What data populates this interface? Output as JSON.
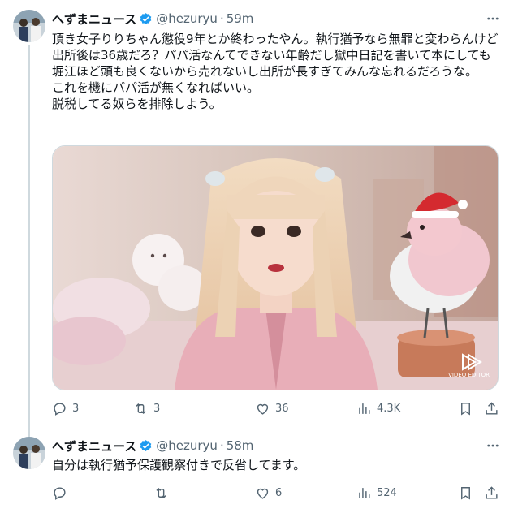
{
  "tweets": [
    {
      "display_name": "へずまニュース",
      "handle": "@hezuryu",
      "separator": "·",
      "time": "59m",
      "text": "頂き女子りりちゃん懲役9年とか終わったやん。執行猶予なら無罪と変わらんけど出所後は36歳だろ？パパ活なんてできない年齢だし獄中日記を書いて本にしても堀江ほど頭も良くないから売れないし出所が長すぎてみんな忘れるだろうな。\nこれを機にパパ活が無くなればいい。\n脱税してる奴らを排除しよう。",
      "media_watermark": "VIDEO EDITOR",
      "actions": {
        "replies": "3",
        "reposts": "3",
        "likes": "36",
        "views": "4.3K"
      }
    },
    {
      "display_name": "へずまニュース",
      "handle": "@hezuryu",
      "separator": "·",
      "time": "58m",
      "text": "自分は執行猶予保護観察付きで反省してます。",
      "actions": {
        "replies": "",
        "reposts": "",
        "likes": "6",
        "views": "524"
      }
    }
  ],
  "colors": {
    "text": "#0f1419",
    "secondary": "#536471",
    "verified": "#1d9bf0",
    "border": "#cfd9de"
  },
  "icons": [
    "verified-badge-icon",
    "more-icon",
    "reply-icon",
    "repost-icon",
    "like-icon",
    "views-icon",
    "bookmark-icon",
    "share-icon"
  ]
}
